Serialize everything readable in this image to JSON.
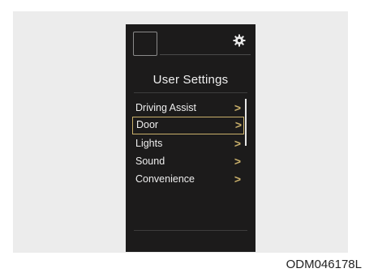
{
  "display": {
    "title": "User Settings",
    "settings_icon": "gear-icon",
    "accent_color": "#c9b06b",
    "menu": [
      {
        "label": "Driving Assist",
        "chevron": ">",
        "selected": false
      },
      {
        "label": "Door",
        "chevron": ">",
        "selected": true
      },
      {
        "label": "Lights",
        "chevron": ">",
        "selected": false
      },
      {
        "label": "Sound",
        "chevron": ">",
        "selected": false
      },
      {
        "label": "Convenience",
        "chevron": ">",
        "selected": false
      }
    ]
  },
  "figure_code": "ODM046178L"
}
